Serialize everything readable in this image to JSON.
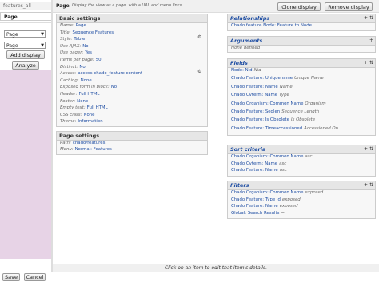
{
  "displays": {
    "tabs": [
      "features_all",
      "Page"
    ],
    "select1": "Page",
    "select2": "Page",
    "add_display": "Add display",
    "analyze": "Analyze"
  },
  "topbar": {
    "display_name": "Page",
    "help_text": "Display the view as a page, with a URL and menu links.",
    "clone_button": "Clone display",
    "remove_button": "Remove display"
  },
  "basic_settings": {
    "title": "Basic settings",
    "rows": [
      {
        "label": "Name:",
        "value": "Page"
      },
      {
        "label": "Title:",
        "value": "Sequence Features"
      },
      {
        "label": "Style:",
        "value": "Table"
      },
      {
        "label": "Use AJAX:",
        "value": "No"
      },
      {
        "label": "Use pager:",
        "value": "Yes"
      },
      {
        "label": "Items per page:",
        "value": "50"
      },
      {
        "label": "Distinct:",
        "value": "No"
      },
      {
        "label": "Access:",
        "value": "access chado_feature content"
      },
      {
        "label": "Caching:",
        "value": "None"
      },
      {
        "label": "Exposed form in block:",
        "value": "No"
      },
      {
        "label": "Header:",
        "value": "Full HTML"
      },
      {
        "label": "Footer:",
        "value": "None"
      },
      {
        "label": "Empty text:",
        "value": "Full HTML"
      },
      {
        "label": "CSS class:",
        "value": "None"
      },
      {
        "label": "Theme:",
        "value": "Information"
      }
    ]
  },
  "page_settings": {
    "title": "Page settings",
    "rows": [
      {
        "label": "Path:",
        "value": "chado/features"
      },
      {
        "label": "Menu:",
        "value": "Normal: Features"
      }
    ]
  },
  "relationships": {
    "title": "Relationships",
    "icon": "+ ⇅",
    "items": [
      {
        "value": "Chado feature Node: Feature to Node",
        "sub": ""
      }
    ]
  },
  "arguments": {
    "title": "Arguments",
    "icon": "+",
    "empty": "None defined"
  },
  "fields": {
    "title": "Fields",
    "icon": "+ ⇅",
    "items": [
      {
        "value": "Node: Nid",
        "sub": "Nid"
      },
      {
        "value": "Chado Feature: Uniquename",
        "sub": "Unique Name"
      },
      {
        "value": "Chado Feature: Name",
        "sub": "Name"
      },
      {
        "value": "Chado Cvterm: Name",
        "sub": "Type"
      },
      {
        "value": "Chado Organism: Common Name",
        "sub": "Organism"
      },
      {
        "value": "Chado Feature: Seqlen",
        "sub": "Sequence Length"
      },
      {
        "value": "Chado Feature: Is Obsolete",
        "sub": "Is Obsolete"
      },
      {
        "value": "Chado Feature: Timeaccessioned",
        "sub": "Accessioned On"
      }
    ]
  },
  "sort_criteria": {
    "title": "Sort criteria",
    "icon": "+ ⇅",
    "items": [
      {
        "value": "Chado Organism: Common Name",
        "sub": "asc"
      },
      {
        "value": "Chado Cvterm: Name",
        "sub": "asc"
      },
      {
        "value": "Chado Feature: Name",
        "sub": "asc"
      }
    ]
  },
  "filters": {
    "title": "Filters",
    "icon": "+ ⇅",
    "items": [
      {
        "value": "Chado Organism: Common Name",
        "sub": "exposed"
      },
      {
        "value": "Chado Feature: Type Id",
        "sub": "exposed"
      },
      {
        "value": "Chado Feature: Name",
        "sub": "exposed"
      },
      {
        "value": "Global: Search Results",
        "sub": "="
      }
    ]
  },
  "footer": {
    "hint": "Click on an item to edit that item's details.",
    "save": "Save",
    "cancel": "Cancel"
  }
}
